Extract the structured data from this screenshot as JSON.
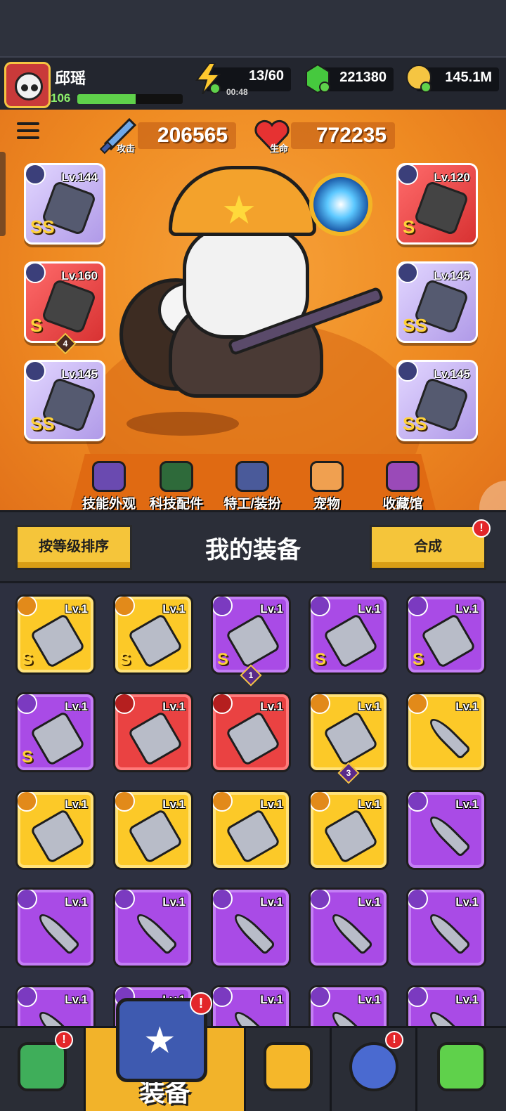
{
  "player": {
    "name": "邱瑶",
    "level": "106",
    "xp_fraction": 0.55
  },
  "resources": {
    "energy": "13/60",
    "energy_timer": "00:48",
    "gems": "221380",
    "coins": "145.1M"
  },
  "stats": {
    "attack_value": "206565",
    "attack_label": "攻击",
    "hp_value": "772235",
    "hp_label": "生命"
  },
  "equipped": {
    "left": [
      {
        "level": "Lv.144",
        "grade": "SS",
        "rarity": "purple",
        "icon": "weapon-staff-icon"
      },
      {
        "level": "Lv.160",
        "grade": "S",
        "rarity": "red",
        "icon": "necklace-icon",
        "badge": "4"
      },
      {
        "level": "Lv.145",
        "grade": "SS",
        "rarity": "purple",
        "icon": "gloves-icon"
      }
    ],
    "right": [
      {
        "level": "Lv.120",
        "grade": "S",
        "rarity": "red",
        "icon": "armor-icon"
      },
      {
        "level": "Lv.145",
        "grade": "SS",
        "rarity": "purple",
        "icon": "belt-icon"
      },
      {
        "level": "Lv.145",
        "grade": "SS",
        "rarity": "purple",
        "icon": "boots-icon"
      }
    ]
  },
  "hero_tabs": [
    {
      "label": "技能外观",
      "icon": "skill-skin-icon",
      "alert": false
    },
    {
      "label": "科技配件",
      "icon": "tech-parts-icon",
      "alert": true
    },
    {
      "label": "特工/装扮",
      "icon": "agent-outfit-icon",
      "alert": false
    },
    {
      "label": "宠物",
      "icon": "pet-icon",
      "alert": true
    },
    {
      "label": "收藏馆",
      "icon": "collection-icon",
      "alert": false
    }
  ],
  "panel": {
    "sort_label": "按等级排序",
    "title": "我的装备",
    "merge_label": "合成",
    "alert": "!"
  },
  "inventory": [
    {
      "level": "Lv.1",
      "rarity": "yellow",
      "grade": "S",
      "icon": "sword-icon"
    },
    {
      "level": "Lv.1",
      "rarity": "yellow",
      "grade": "S",
      "icon": "gauntlet-icon"
    },
    {
      "level": "Lv.1",
      "rarity": "purple",
      "grade": "S",
      "icon": "boots-icon",
      "badge": "1"
    },
    {
      "level": "Lv.1",
      "rarity": "purple",
      "grade": "S",
      "icon": "armor-icon"
    },
    {
      "level": "Lv.1",
      "rarity": "purple",
      "grade": "S",
      "icon": "belt-icon"
    },
    {
      "level": "Lv.1",
      "rarity": "purple",
      "grade": "S",
      "icon": "boots-icon"
    },
    {
      "level": "Lv.1",
      "rarity": "red",
      "grade": "",
      "icon": "spiked-collar-icon"
    },
    {
      "level": "Lv.1",
      "rarity": "red",
      "grade": "",
      "icon": "claw-glove-icon"
    },
    {
      "level": "Lv.1",
      "rarity": "yellow",
      "grade": "",
      "icon": "boots-icon",
      "badge": "3"
    },
    {
      "level": "Lv.1",
      "rarity": "yellow",
      "grade": "",
      "icon": "kunai-icon"
    },
    {
      "level": "Lv.1",
      "rarity": "yellow",
      "grade": "",
      "icon": "katana-icon"
    },
    {
      "level": "Lv.1",
      "rarity": "yellow",
      "grade": "",
      "icon": "revolver-icon"
    },
    {
      "level": "Lv.1",
      "rarity": "yellow",
      "grade": "",
      "icon": "club-icon"
    },
    {
      "level": "Lv.1",
      "rarity": "yellow",
      "grade": "",
      "icon": "fang-necklace-icon"
    },
    {
      "level": "Lv.1",
      "rarity": "purple",
      "grade": "",
      "icon": "kunai-icon"
    },
    {
      "level": "Lv.1",
      "rarity": "purple",
      "grade": "",
      "icon": "kunai-icon"
    },
    {
      "level": "Lv.1",
      "rarity": "purple",
      "grade": "",
      "icon": "kunai-icon"
    },
    {
      "level": "Lv.1",
      "rarity": "purple",
      "grade": "",
      "icon": "kunai-icon"
    },
    {
      "level": "Lv.1",
      "rarity": "purple",
      "grade": "",
      "icon": "kunai-icon"
    },
    {
      "level": "Lv.1",
      "rarity": "purple",
      "grade": "",
      "icon": "kunai-icon"
    },
    {
      "level": "Lv.1",
      "rarity": "purple",
      "grade": "",
      "icon": "kunai-icon"
    },
    {
      "level": "Lv.1",
      "rarity": "purple",
      "grade": "",
      "icon": "kunai-icon"
    },
    {
      "level": "Lv.1",
      "rarity": "purple",
      "grade": "",
      "icon": "kunai-icon"
    },
    {
      "level": "Lv.1",
      "rarity": "purple",
      "grade": "",
      "icon": "kunai-icon"
    },
    {
      "level": "Lv.1",
      "rarity": "purple",
      "grade": "",
      "icon": "kunai-icon"
    }
  ],
  "nav": {
    "active_label": "装备",
    "items": [
      {
        "icon": "shop-icon",
        "alert": true
      },
      {
        "icon": "equipment-icon",
        "alert": true
      },
      {
        "icon": "battle-icon",
        "alert": false
      },
      {
        "icon": "planet-icon",
        "alert": true
      },
      {
        "icon": "dna-icon",
        "alert": false
      }
    ]
  },
  "colors": {
    "hero_bg": "#ef8b22",
    "yellow_rarity": "#fcc928",
    "purple_rarity": "#a94be6",
    "red_rarity": "#ea4242",
    "alert": "#e3262a"
  }
}
